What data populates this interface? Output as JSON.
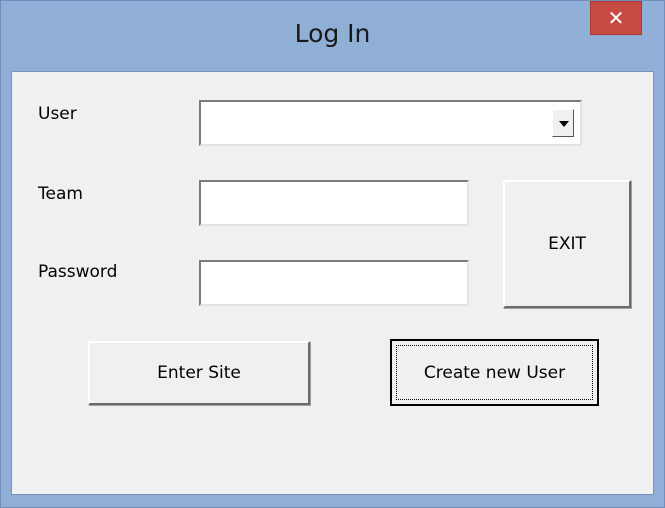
{
  "window": {
    "title": "Log In",
    "close_icon": "close-icon",
    "close_glyph": "✕",
    "colors": {
      "frame": "#8fafd6",
      "client": "#f0f0f0",
      "close": "#c74b43"
    }
  },
  "form": {
    "user_label": "User",
    "user_value": "",
    "team_label": "Team",
    "team_value": "",
    "password_label": "Password",
    "password_value": ""
  },
  "buttons": {
    "exit": "EXIT",
    "enter_site": "Enter Site",
    "create_user": "Create new User"
  }
}
